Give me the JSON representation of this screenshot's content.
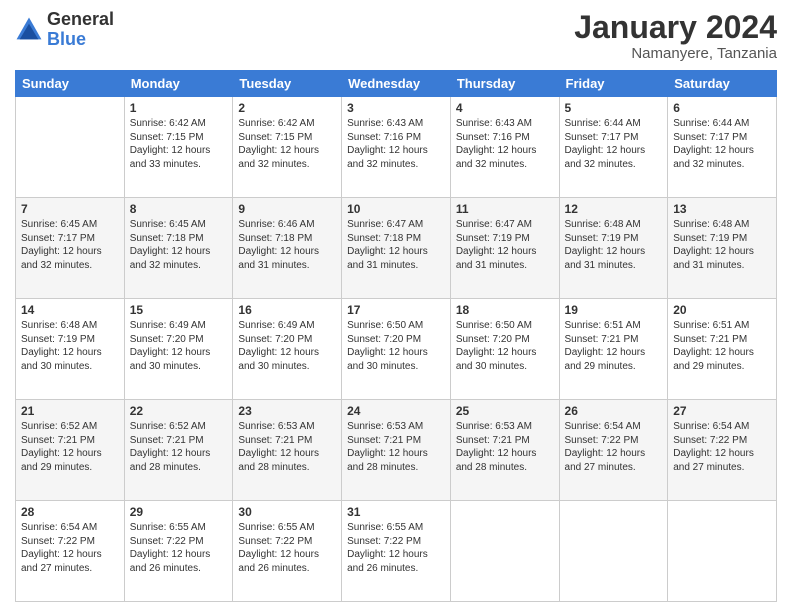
{
  "header": {
    "logo_general": "General",
    "logo_blue": "Blue",
    "main_title": "January 2024",
    "subtitle": "Namanyere, Tanzania"
  },
  "calendar": {
    "headers": [
      "Sunday",
      "Monday",
      "Tuesday",
      "Wednesday",
      "Thursday",
      "Friday",
      "Saturday"
    ],
    "weeks": [
      [
        {
          "day": "",
          "sunrise": "",
          "sunset": "",
          "daylight": ""
        },
        {
          "day": "1",
          "sunrise": "Sunrise: 6:42 AM",
          "sunset": "Sunset: 7:15 PM",
          "daylight": "Daylight: 12 hours and 33 minutes."
        },
        {
          "day": "2",
          "sunrise": "Sunrise: 6:42 AM",
          "sunset": "Sunset: 7:15 PM",
          "daylight": "Daylight: 12 hours and 32 minutes."
        },
        {
          "day": "3",
          "sunrise": "Sunrise: 6:43 AM",
          "sunset": "Sunset: 7:16 PM",
          "daylight": "Daylight: 12 hours and 32 minutes."
        },
        {
          "day": "4",
          "sunrise": "Sunrise: 6:43 AM",
          "sunset": "Sunset: 7:16 PM",
          "daylight": "Daylight: 12 hours and 32 minutes."
        },
        {
          "day": "5",
          "sunrise": "Sunrise: 6:44 AM",
          "sunset": "Sunset: 7:17 PM",
          "daylight": "Daylight: 12 hours and 32 minutes."
        },
        {
          "day": "6",
          "sunrise": "Sunrise: 6:44 AM",
          "sunset": "Sunset: 7:17 PM",
          "daylight": "Daylight: 12 hours and 32 minutes."
        }
      ],
      [
        {
          "day": "7",
          "sunrise": "Sunrise: 6:45 AM",
          "sunset": "Sunset: 7:17 PM",
          "daylight": "Daylight: 12 hours and 32 minutes."
        },
        {
          "day": "8",
          "sunrise": "Sunrise: 6:45 AM",
          "sunset": "Sunset: 7:18 PM",
          "daylight": "Daylight: 12 hours and 32 minutes."
        },
        {
          "day": "9",
          "sunrise": "Sunrise: 6:46 AM",
          "sunset": "Sunset: 7:18 PM",
          "daylight": "Daylight: 12 hours and 31 minutes."
        },
        {
          "day": "10",
          "sunrise": "Sunrise: 6:47 AM",
          "sunset": "Sunset: 7:18 PM",
          "daylight": "Daylight: 12 hours and 31 minutes."
        },
        {
          "day": "11",
          "sunrise": "Sunrise: 6:47 AM",
          "sunset": "Sunset: 7:19 PM",
          "daylight": "Daylight: 12 hours and 31 minutes."
        },
        {
          "day": "12",
          "sunrise": "Sunrise: 6:48 AM",
          "sunset": "Sunset: 7:19 PM",
          "daylight": "Daylight: 12 hours and 31 minutes."
        },
        {
          "day": "13",
          "sunrise": "Sunrise: 6:48 AM",
          "sunset": "Sunset: 7:19 PM",
          "daylight": "Daylight: 12 hours and 31 minutes."
        }
      ],
      [
        {
          "day": "14",
          "sunrise": "Sunrise: 6:48 AM",
          "sunset": "Sunset: 7:19 PM",
          "daylight": "Daylight: 12 hours and 30 minutes."
        },
        {
          "day": "15",
          "sunrise": "Sunrise: 6:49 AM",
          "sunset": "Sunset: 7:20 PM",
          "daylight": "Daylight: 12 hours and 30 minutes."
        },
        {
          "day": "16",
          "sunrise": "Sunrise: 6:49 AM",
          "sunset": "Sunset: 7:20 PM",
          "daylight": "Daylight: 12 hours and 30 minutes."
        },
        {
          "day": "17",
          "sunrise": "Sunrise: 6:50 AM",
          "sunset": "Sunset: 7:20 PM",
          "daylight": "Daylight: 12 hours and 30 minutes."
        },
        {
          "day": "18",
          "sunrise": "Sunrise: 6:50 AM",
          "sunset": "Sunset: 7:20 PM",
          "daylight": "Daylight: 12 hours and 30 minutes."
        },
        {
          "day": "19",
          "sunrise": "Sunrise: 6:51 AM",
          "sunset": "Sunset: 7:21 PM",
          "daylight": "Daylight: 12 hours and 29 minutes."
        },
        {
          "day": "20",
          "sunrise": "Sunrise: 6:51 AM",
          "sunset": "Sunset: 7:21 PM",
          "daylight": "Daylight: 12 hours and 29 minutes."
        }
      ],
      [
        {
          "day": "21",
          "sunrise": "Sunrise: 6:52 AM",
          "sunset": "Sunset: 7:21 PM",
          "daylight": "Daylight: 12 hours and 29 minutes."
        },
        {
          "day": "22",
          "sunrise": "Sunrise: 6:52 AM",
          "sunset": "Sunset: 7:21 PM",
          "daylight": "Daylight: 12 hours and 28 minutes."
        },
        {
          "day": "23",
          "sunrise": "Sunrise: 6:53 AM",
          "sunset": "Sunset: 7:21 PM",
          "daylight": "Daylight: 12 hours and 28 minutes."
        },
        {
          "day": "24",
          "sunrise": "Sunrise: 6:53 AM",
          "sunset": "Sunset: 7:21 PM",
          "daylight": "Daylight: 12 hours and 28 minutes."
        },
        {
          "day": "25",
          "sunrise": "Sunrise: 6:53 AM",
          "sunset": "Sunset: 7:21 PM",
          "daylight": "Daylight: 12 hours and 28 minutes."
        },
        {
          "day": "26",
          "sunrise": "Sunrise: 6:54 AM",
          "sunset": "Sunset: 7:22 PM",
          "daylight": "Daylight: 12 hours and 27 minutes."
        },
        {
          "day": "27",
          "sunrise": "Sunrise: 6:54 AM",
          "sunset": "Sunset: 7:22 PM",
          "daylight": "Daylight: 12 hours and 27 minutes."
        }
      ],
      [
        {
          "day": "28",
          "sunrise": "Sunrise: 6:54 AM",
          "sunset": "Sunset: 7:22 PM",
          "daylight": "Daylight: 12 hours and 27 minutes."
        },
        {
          "day": "29",
          "sunrise": "Sunrise: 6:55 AM",
          "sunset": "Sunset: 7:22 PM",
          "daylight": "Daylight: 12 hours and 26 minutes."
        },
        {
          "day": "30",
          "sunrise": "Sunrise: 6:55 AM",
          "sunset": "Sunset: 7:22 PM",
          "daylight": "Daylight: 12 hours and 26 minutes."
        },
        {
          "day": "31",
          "sunrise": "Sunrise: 6:55 AM",
          "sunset": "Sunset: 7:22 PM",
          "daylight": "Daylight: 12 hours and 26 minutes."
        },
        {
          "day": "",
          "sunrise": "",
          "sunset": "",
          "daylight": ""
        },
        {
          "day": "",
          "sunrise": "",
          "sunset": "",
          "daylight": ""
        },
        {
          "day": "",
          "sunrise": "",
          "sunset": "",
          "daylight": ""
        }
      ]
    ]
  }
}
